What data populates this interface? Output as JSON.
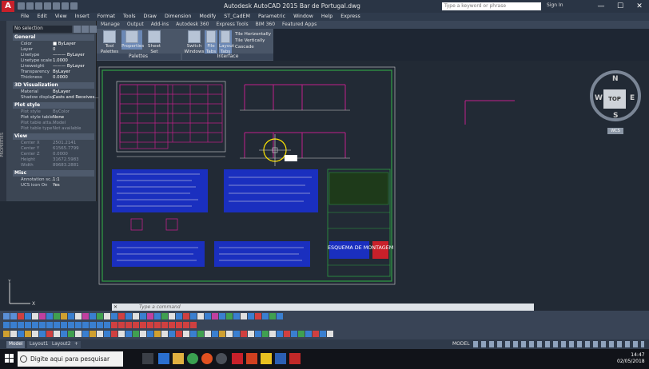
{
  "app": {
    "title": "Autodesk AutoCAD 2015    Bar de Portugal.dwg",
    "search_placeholder": "Type a keyword or phrase",
    "sign_in": "Sign In",
    "window_controls": [
      "—",
      "☐",
      "✕"
    ]
  },
  "menu": [
    "File",
    "Edit",
    "View",
    "Insert",
    "Format",
    "Tools",
    "Draw",
    "Dimension",
    "Modify",
    "ST_CadEM",
    "Parametric",
    "Window",
    "Help",
    "Express"
  ],
  "ribbon_tabs": [
    "Manage",
    "Output",
    "Add-ins",
    "Autodesk 360",
    "Express Tools",
    "BIM 360",
    "Featured Apps"
  ],
  "ribbon": {
    "buttons": [
      {
        "label": "Tool Palettes"
      },
      {
        "label": "Properties"
      },
      {
        "label": "Sheet Set Manager"
      },
      {
        "label": "Switch Windows"
      },
      {
        "label": "File Tabs"
      },
      {
        "label": "Layout Tabs"
      }
    ],
    "small_buttons": [
      "Tile Horizontally",
      "Tile Vertically",
      "Cascade"
    ],
    "groups": [
      "Palettes",
      "Interface"
    ]
  },
  "properties": {
    "selection": "No selection",
    "palette_label": "PROPERTIES",
    "sections": [
      {
        "name": "General",
        "rows": [
          {
            "k": "Color",
            "v": "■ ByLayer"
          },
          {
            "k": "Layer",
            "v": "0"
          },
          {
            "k": "Linetype",
            "v": "——— ByLayer"
          },
          {
            "k": "Linetype scale",
            "v": "1.0000"
          },
          {
            "k": "Lineweight",
            "v": "——— ByLayer"
          },
          {
            "k": "Transparency",
            "v": "ByLayer"
          },
          {
            "k": "Thickness",
            "v": "0.0000"
          }
        ]
      },
      {
        "name": "3D Visualization",
        "rows": [
          {
            "k": "Material",
            "v": "ByLayer"
          },
          {
            "k": "Shadow display",
            "v": "Casts and Receives..."
          }
        ]
      },
      {
        "name": "Plot style",
        "rows": [
          {
            "k": "Plot style",
            "v": "ByColor",
            "dim": true
          },
          {
            "k": "Plot style table",
            "v": "None"
          },
          {
            "k": "Plot table atta...",
            "v": "Model",
            "dim": true
          },
          {
            "k": "Plot table type",
            "v": "Not available",
            "dim": true
          }
        ]
      },
      {
        "name": "View",
        "rows": [
          {
            "k": "Center X",
            "v": "2501.2141",
            "dim": true
          },
          {
            "k": "Center Y",
            "v": "61565.7799",
            "dim": true
          },
          {
            "k": "Center Z",
            "v": "0.0000",
            "dim": true
          },
          {
            "k": "Height",
            "v": "31672.5983",
            "dim": true
          },
          {
            "k": "Width",
            "v": "89683.2881",
            "dim": true
          }
        ]
      },
      {
        "name": "Misc",
        "rows": [
          {
            "k": "Annotation sc...",
            "v": "1:1"
          },
          {
            "k": "UCS icon On",
            "v": "Yes"
          }
        ]
      }
    ]
  },
  "viewcube": {
    "n": "N",
    "s": "S",
    "e": "E",
    "w": "W",
    "face": "TOP",
    "wcs": "WCS"
  },
  "command": {
    "placeholder": "Type a command",
    "close": "✕"
  },
  "drawing": {
    "stamp_text": "ESQUEMA DE MONTAGEM"
  },
  "layout_tabs": [
    "Model",
    "Layout1",
    "Layout2",
    "+"
  ],
  "status": {
    "model": "MODEL"
  },
  "taskbar": {
    "search": "Digite aqui para pesquisar",
    "time": "14:47",
    "date": "02/05/2018"
  },
  "colors": {
    "accent_red": "#c8202a",
    "canvas": "#222a35",
    "drawing_green": "#2f9e44",
    "drawing_blue": "#1a2fbf",
    "drawing_magenta": "#c0208a",
    "cursor_yellow": "#ffe600"
  }
}
